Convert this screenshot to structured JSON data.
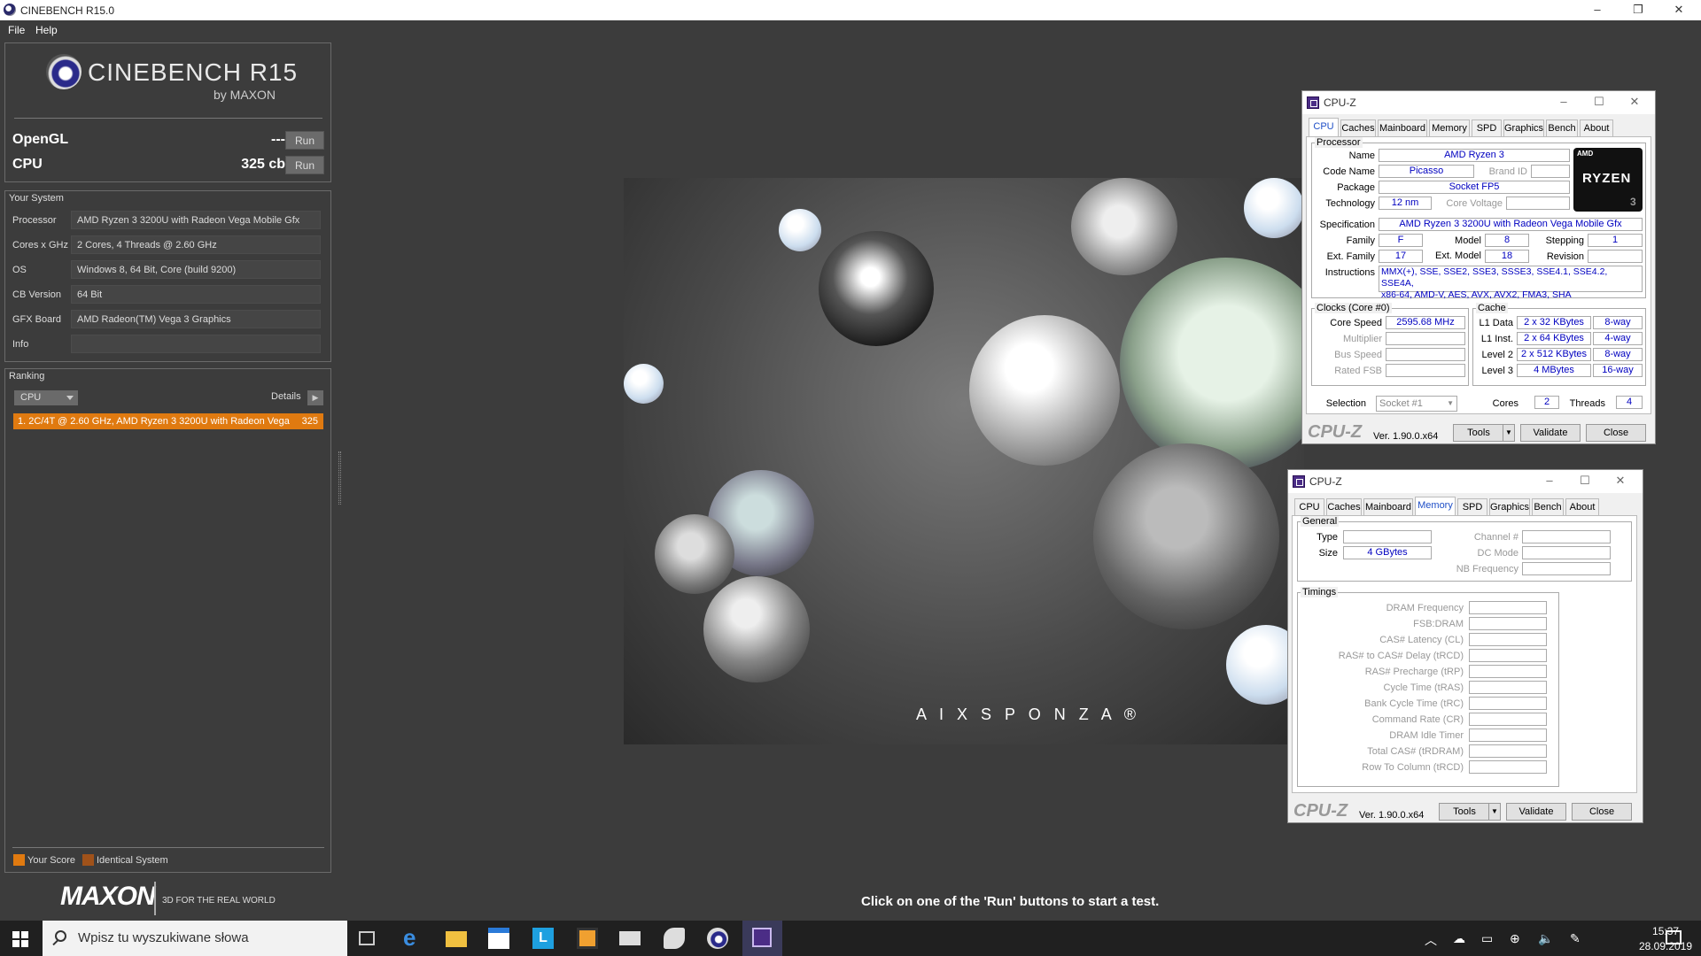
{
  "window": {
    "title": "CINEBENCH R15.0",
    "minimize": "–",
    "maximize": "❐",
    "close": "✕"
  },
  "menu": {
    "file": "File",
    "help": "Help"
  },
  "logo": {
    "title": "CINEBENCH R15",
    "subtitle": "by MAXON"
  },
  "tests": {
    "opengl": {
      "label": "OpenGL",
      "value": "---",
      "run": "Run"
    },
    "cpu": {
      "label": "CPU",
      "value": "325 cb",
      "run": "Run"
    }
  },
  "system": {
    "header": "Your System",
    "rows": [
      {
        "label": "Processor",
        "value": "AMD Ryzen 3 3200U with Radeon Vega Mobile Gfx"
      },
      {
        "label": "Cores x GHz",
        "value": "2 Cores, 4 Threads @ 2.60 GHz"
      },
      {
        "label": "OS",
        "value": "Windows 8, 64 Bit, Core (build 9200)"
      },
      {
        "label": "CB Version",
        "value": "64 Bit"
      },
      {
        "label": "GFX Board",
        "value": "AMD Radeon(TM) Vega 3 Graphics"
      },
      {
        "label": "Info",
        "value": ""
      }
    ]
  },
  "ranking": {
    "header": "Ranking",
    "combo": "CPU",
    "details": "Details",
    "row": {
      "text": "1. 2C/4T @ 2.60 GHz, AMD Ryzen 3 3200U with Radeon Vega",
      "score": "325"
    },
    "legend": {
      "your": "Your Score",
      "identical": "Identical System",
      "your_color": "#e07a10",
      "identical_color": "#a0521a"
    }
  },
  "footer": {
    "maxon": "MAXON",
    "tagline": "3D FOR THE REAL WORLD",
    "message": "Click on one of the 'Run' buttons to start a test."
  },
  "render": {
    "watermark": "A I X S P O N Z A ®"
  },
  "cpuz1": {
    "title": "CPU-Z",
    "tabs": [
      "CPU",
      "Caches",
      "Mainboard",
      "Memory",
      "SPD",
      "Graphics",
      "Bench",
      "About"
    ],
    "processor": {
      "group": "Processor",
      "name_l": "Name",
      "name": "AMD Ryzen 3",
      "code_l": "Code Name",
      "code": "Picasso",
      "brand_l": "Brand ID",
      "brand": "",
      "package_l": "Package",
      "package": "Socket FP5",
      "tech_l": "Technology",
      "tech": "12 nm",
      "volt_l": "Core Voltage",
      "volt": "",
      "spec_l": "Specification",
      "spec": "AMD Ryzen 3 3200U with Radeon Vega Mobile Gfx",
      "family_l": "Family",
      "family": "F",
      "model_l": "Model",
      "model": "8",
      "step_l": "Stepping",
      "step": "1",
      "extfam_l": "Ext. Family",
      "extfam": "17",
      "extmod_l": "Ext. Model",
      "extmod": "18",
      "rev_l": "Revision",
      "rev": "",
      "instr_l": "Instructions",
      "instr1": "MMX(+), SSE, SSE2, SSE3, SSSE3, SSE4.1, SSE4.2, SSE4A,",
      "instr2": "x86-64, AMD-V, AES, AVX, AVX2, FMA3, SHA",
      "logo_amd": "AMD",
      "logo_ryzen": "RYZEN",
      "logo_num": "3"
    },
    "clocks": {
      "group": "Clocks (Core #0)",
      "speed_l": "Core Speed",
      "speed": "2595.68 MHz",
      "mult_l": "Multiplier",
      "bus_l": "Bus Speed",
      "fsb_l": "Rated FSB"
    },
    "cache": {
      "group": "Cache",
      "rows": [
        {
          "l": "L1 Data",
          "v": "2 x 32 KBytes",
          "w": "8-way"
        },
        {
          "l": "L1 Inst.",
          "v": "2 x 64 KBytes",
          "w": "4-way"
        },
        {
          "l": "Level 2",
          "v": "2 x 512 KBytes",
          "w": "8-way"
        },
        {
          "l": "Level 3",
          "v": "4 MBytes",
          "w": "16-way"
        }
      ]
    },
    "sel": {
      "l": "Selection",
      "v": "Socket #1",
      "cores_l": "Cores",
      "cores": "2",
      "threads_l": "Threads",
      "threads": "4"
    },
    "bottom": {
      "brand": "CPU-Z",
      "ver": "Ver. 1.90.0.x64",
      "tools": "Tools",
      "validate": "Validate",
      "close": "Close"
    }
  },
  "cpuz2": {
    "title": "CPU-Z",
    "tabs": [
      "CPU",
      "Caches",
      "Mainboard",
      "Memory",
      "SPD",
      "Graphics",
      "Bench",
      "About"
    ],
    "general": {
      "group": "General",
      "type_l": "Type",
      "type": "",
      "size_l": "Size",
      "size": "4 GBytes",
      "chan_l": "Channel #",
      "dc_l": "DC Mode",
      "nb_l": "NB Frequency"
    },
    "timings": {
      "group": "Timings",
      "rows": [
        "DRAM Frequency",
        "FSB:DRAM",
        "CAS# Latency (CL)",
        "RAS# to CAS# Delay (tRCD)",
        "RAS# Precharge (tRP)",
        "Cycle Time (tRAS)",
        "Bank Cycle Time (tRC)",
        "Command Rate (CR)",
        "DRAM Idle Timer",
        "Total CAS# (tRDRAM)",
        "Row To Column (tRCD)"
      ]
    },
    "bottom": {
      "brand": "CPU-Z",
      "ver": "Ver. 1.90.0.x64",
      "tools": "Tools",
      "validate": "Validate",
      "close": "Close"
    }
  },
  "taskbar": {
    "search": "Wpisz tu wyszukiwane słowa",
    "time": "15:37",
    "date": "28.09.2019"
  }
}
